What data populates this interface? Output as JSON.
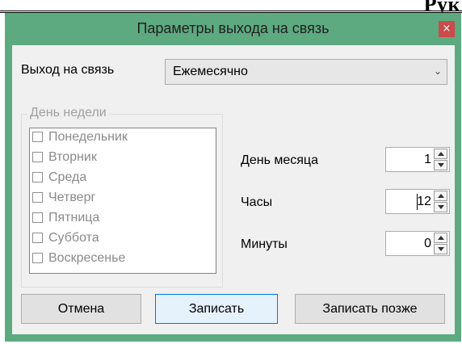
{
  "document": {
    "title_fragment": "Рук"
  },
  "dialog": {
    "title": "Параметры выхода на связь",
    "close_glyph": "×",
    "schedule": {
      "label": "Выход на связь",
      "value": "Ежемесячно",
      "arrow_glyph": "⌄"
    },
    "weekday_group": {
      "legend": "День недели",
      "days": [
        {
          "label": "Понедельник",
          "checked": false
        },
        {
          "label": "Вторник",
          "checked": false
        },
        {
          "label": "Среда",
          "checked": false
        },
        {
          "label": "Четверг",
          "checked": false
        },
        {
          "label": "Пятница",
          "checked": false
        },
        {
          "label": "Суббота",
          "checked": false
        },
        {
          "label": "Воскресенье",
          "checked": false
        }
      ]
    },
    "fields": {
      "day_of_month": {
        "label": "День месяца",
        "value": "1"
      },
      "hours": {
        "label": "Часы",
        "value": "12"
      },
      "minutes": {
        "label": "Минуты",
        "value": "0"
      }
    },
    "buttons": {
      "cancel": "Отмена",
      "save": "Записать",
      "save_later": "Записать позже"
    }
  },
  "colors": {
    "frame": "#5eaa80",
    "close": "#c94b4b",
    "default_button_border": "#0078d7"
  }
}
